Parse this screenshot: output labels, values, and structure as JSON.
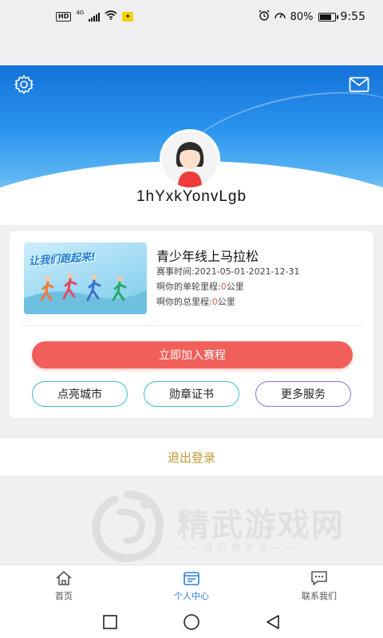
{
  "status_bar": {
    "hd": "HD",
    "network": "4G",
    "battery": "80%",
    "battery_level": 0.8,
    "time": "9:55"
  },
  "profile": {
    "username": "1hYxkYonvLgb"
  },
  "event": {
    "banner_slogan": "让我们跑起来!",
    "title": "青少年线上马拉松",
    "time_label": "赛事时间:",
    "time_value": "2021-05-01-2021-12-31",
    "single_label": "啊你的单轮里程:",
    "single_value": "0",
    "single_unit": "公里",
    "total_label": "啊你的总里程:",
    "total_value": "0",
    "total_unit": "公里"
  },
  "actions": {
    "join": "立即加入赛程",
    "light_city": "点亮城市",
    "medal_cert": "勋章证书",
    "more_services": "更多服务"
  },
  "logout": "退出登录",
  "watermark": {
    "title": "精武游戏网",
    "subtitle": "——排行榜专家——"
  },
  "tabs": [
    {
      "label": "首页",
      "icon": "home-icon"
    },
    {
      "label": "个人中心",
      "icon": "profile-center-icon",
      "active": true
    },
    {
      "label": "联系我们",
      "icon": "chat-icon"
    }
  ],
  "colors": {
    "primary_blue": "#2f7fd9",
    "join_red": "#f15f5a",
    "logout_gold": "#c49a3a",
    "highlight_red": "#e85b4b"
  }
}
